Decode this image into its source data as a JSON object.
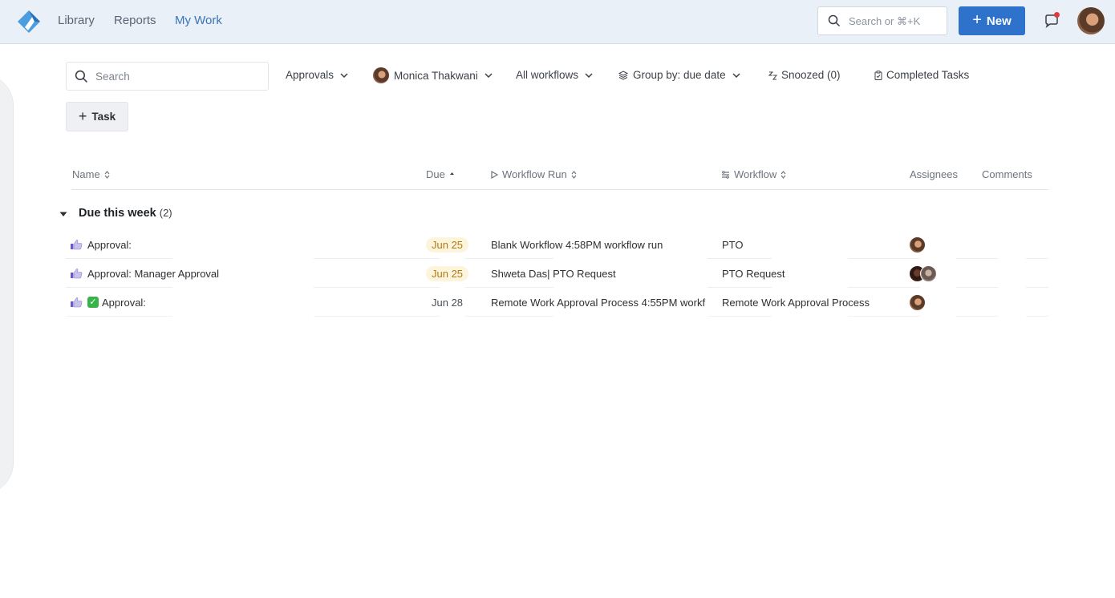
{
  "nav": {
    "links": [
      "Library",
      "Reports",
      "My Work"
    ],
    "active": "My Work",
    "search_placeholder": "Search or ⌘+K",
    "new_label": "New"
  },
  "filters": {
    "search_placeholder": "Search",
    "approvals": "Approvals",
    "user": "Monica Thakwani",
    "workflows": "All workflows",
    "group_by": "Group by: due date",
    "snoozed": "Snoozed (0)",
    "completed": "Completed Tasks"
  },
  "task_button_label": "Task",
  "columns": {
    "name": "Name",
    "due": "Due",
    "workflow_run": "Workflow Run",
    "workflow": "Workflow",
    "assignees": "Assignees",
    "comments": "Comments"
  },
  "group": {
    "title": "Due this week",
    "count": "(2)"
  },
  "rows": [
    {
      "name": "Approval:",
      "has_check": false,
      "due": "Jun 25",
      "due_style": "soon",
      "workflow_run": "Blank Workflow 4:58PM workflow run",
      "workflow": "PTO",
      "assignees": [
        "a1"
      ]
    },
    {
      "name": "Approval: Manager Approval",
      "has_check": false,
      "due": "Jun 25",
      "due_style": "soon",
      "workflow_run": "Shweta Das| PTO Request",
      "workflow": "PTO Request",
      "assignees": [
        "a2",
        "a3"
      ]
    },
    {
      "name": "Approval:",
      "has_check": true,
      "due": "Jun 28",
      "due_style": "normal",
      "workflow_run": "Remote Work Approval Process 4:55PM workf",
      "workflow": "Remote Work Approval Process",
      "assignees": [
        "a1"
      ]
    }
  ],
  "colors": {
    "topbar_bg": "#e9f0f8",
    "accent": "#2f72cc",
    "active_link": "#3a74b8",
    "due_soon_bg": "#fdf4dc",
    "due_soon_text": "#b07a18"
  }
}
